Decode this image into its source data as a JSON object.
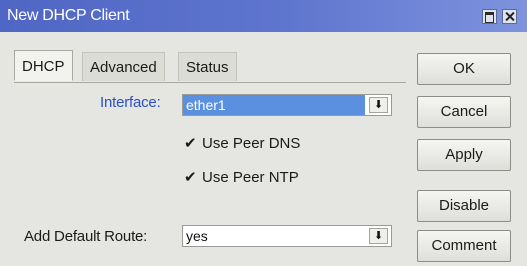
{
  "window": {
    "title": "New DHCP Client"
  },
  "tabs": [
    {
      "label": "DHCP",
      "active": true
    },
    {
      "label": "Advanced",
      "active": false
    },
    {
      "label": "Status",
      "active": false
    }
  ],
  "form": {
    "interface_label": "Interface:",
    "interface_value": "ether1",
    "use_peer_dns_label": "Use Peer DNS",
    "use_peer_dns_checked": true,
    "use_peer_ntp_label": "Use Peer NTP",
    "use_peer_ntp_checked": true,
    "default_route_label": "Add Default Route:",
    "default_route_value": "yes"
  },
  "buttons": {
    "ok": "OK",
    "cancel": "Cancel",
    "apply": "Apply",
    "disable": "Disable",
    "comment": "Comment"
  },
  "icons": {
    "check": "✔",
    "dropdown": "⬇"
  },
  "colors": {
    "titlebar": "#5f76cf",
    "interface_label": "#2d4fc4",
    "selection": "#5b8fe0"
  }
}
